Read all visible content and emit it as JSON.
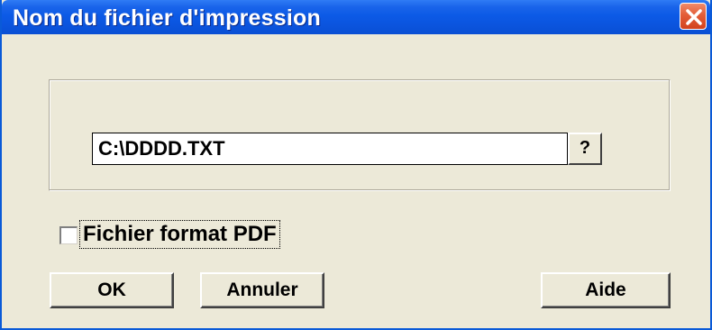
{
  "window": {
    "title": "Nom du fichier d'impression"
  },
  "file": {
    "path": "C:\\DDDD.TXT",
    "browse_label": "?"
  },
  "options": {
    "pdf_label": "Fichier format PDF",
    "pdf_checked": false
  },
  "buttons": {
    "ok_label": "OK",
    "cancel_label": "Annuler",
    "help_label": "Aide"
  },
  "colors": {
    "titlebar": "#0b55df",
    "close_button": "#e35d38",
    "dialog_background": "#ece9d8"
  }
}
